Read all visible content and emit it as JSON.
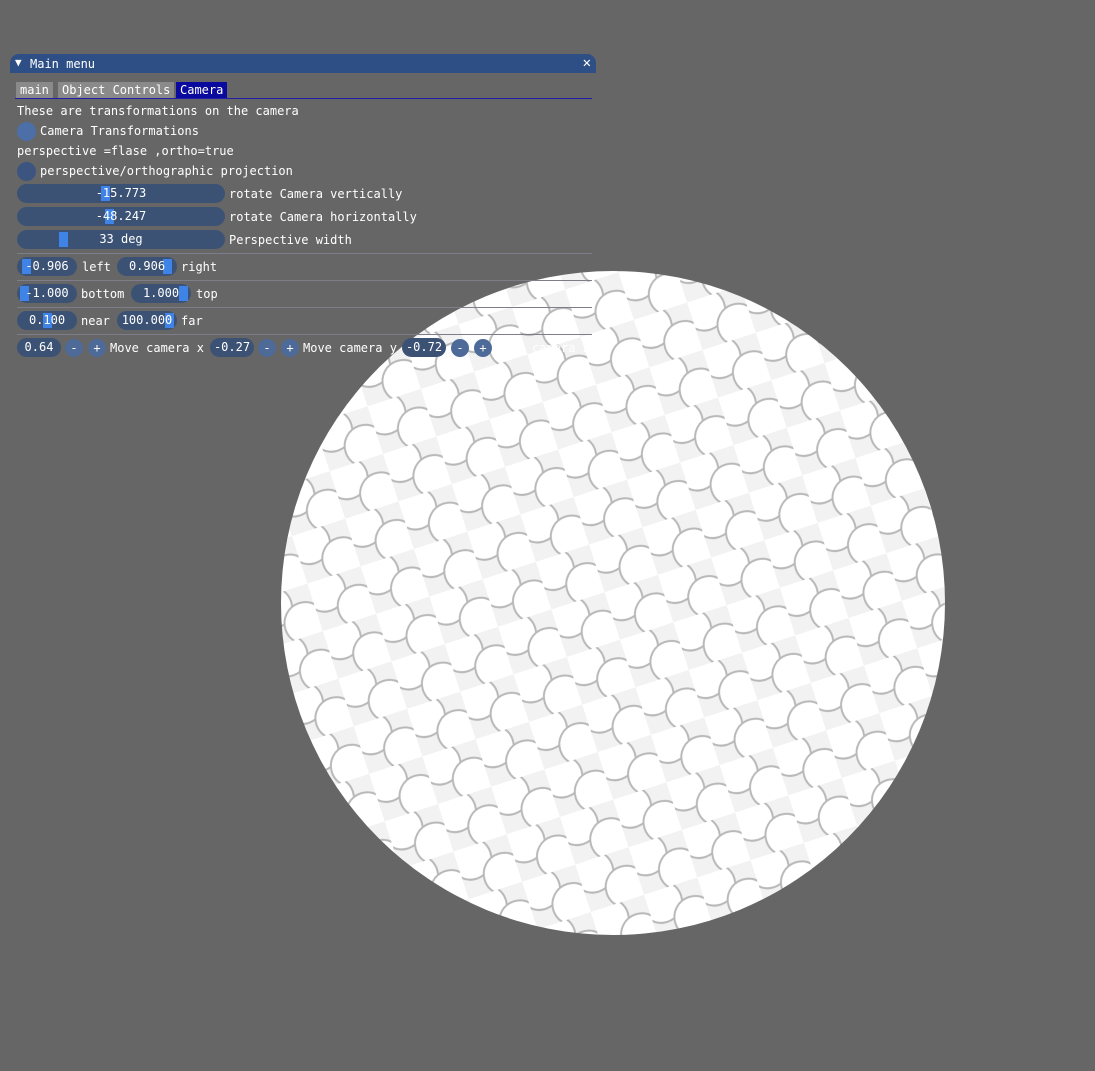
{
  "window": {
    "title": "Main menu",
    "collapse_glyph": "▼",
    "close_glyph": "✕"
  },
  "tabs": [
    {
      "label": "main",
      "active": false
    },
    {
      "label": "Object Controls",
      "active": false
    },
    {
      "label": "Camera",
      "active": true
    }
  ],
  "camera": {
    "description": "These are transformations on the camera",
    "radio1_label": "Camera Transformations",
    "projection_note": "perspective =flase ,ortho=true",
    "radio2_label": "perspective/orthographic projection",
    "sliders": [
      {
        "value": "-15.773",
        "label": "rotate Camera vertically"
      },
      {
        "value": "-48.247",
        "label": "rotate Camera horizontally"
      },
      {
        "value": "33 deg",
        "label": "Perspective width"
      }
    ],
    "left": {
      "value": "-0.906",
      "label": "left"
    },
    "right": {
      "value": "0.906",
      "label": "right"
    },
    "bottom": {
      "value": "-1.000",
      "label": "bottom"
    },
    "top": {
      "value": "1.000",
      "label": "top"
    },
    "near": {
      "value": "0.100",
      "label": "near"
    },
    "far": {
      "value": "100.000",
      "label": "far"
    },
    "move_x": {
      "value": "0.64",
      "label": "Move camera x"
    },
    "move_y": {
      "value": "-0.27",
      "label": "Move camera y"
    },
    "move_z": {
      "value": "-0.72",
      "label": "Move camera z"
    },
    "minus": "-",
    "plus": "+"
  },
  "colors": {
    "background": "#666666",
    "accent": "#3f83e6",
    "title_bar": "#2e4f85",
    "active_tab": "#0a0a9e"
  }
}
